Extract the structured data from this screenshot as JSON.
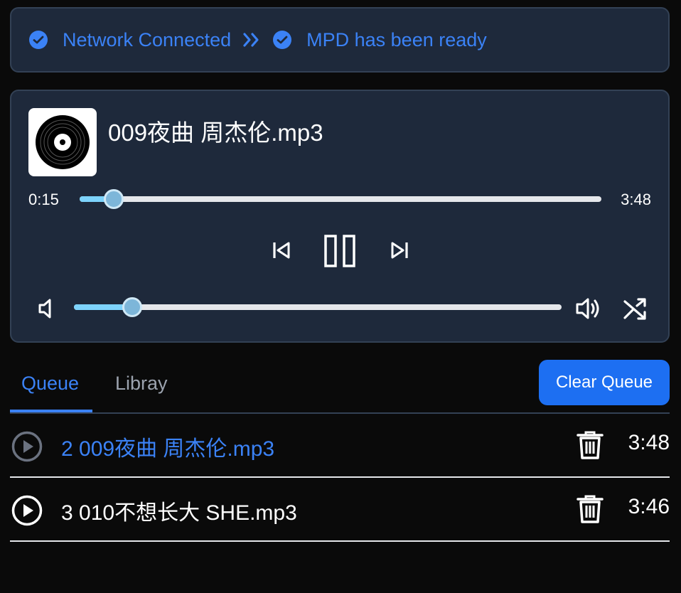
{
  "status": {
    "network": "Network Connected",
    "mpd": "MPD has been ready"
  },
  "player": {
    "title": "009夜曲 周杰伦.mp3",
    "elapsed": "0:15",
    "duration": "3:48",
    "progress_fraction": 0.066,
    "volume_fraction": 0.12
  },
  "tabs": {
    "queue": "Queue",
    "library": "Libray",
    "clear_button": "Clear Queue"
  },
  "queue": [
    {
      "label": "2 009夜曲 周杰伦.mp3",
      "duration": "3:48",
      "active": true
    },
    {
      "label": "3 010不想长大 SHE.mp3",
      "duration": "3:46",
      "active": false
    }
  ],
  "colors": {
    "accent": "#3b82f6",
    "panel": "#1e293b",
    "button": "#1d6ff2"
  }
}
